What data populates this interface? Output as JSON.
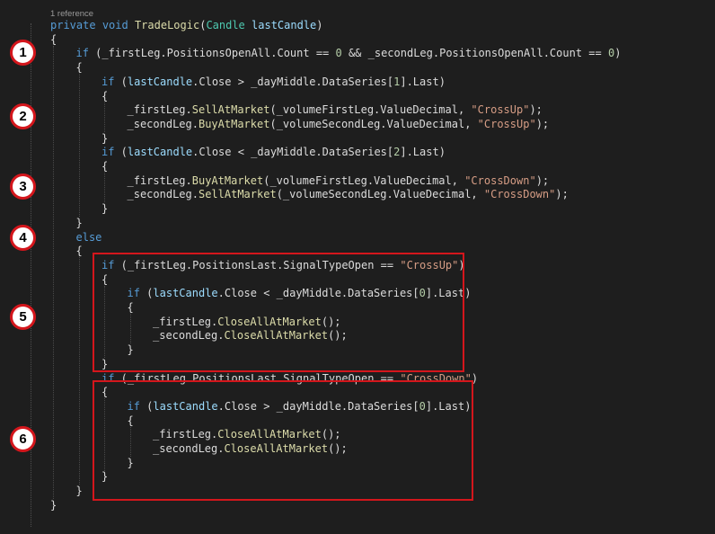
{
  "codelens": "1 reference",
  "markers": [
    "1",
    "2",
    "3",
    "4",
    "5",
    "6"
  ],
  "colors": {
    "background": "#1e1e1e",
    "keyword": "#569cd6",
    "method": "#dcdcaa",
    "type": "#4ec9b0",
    "parameter": "#9cdcfe",
    "string": "#d69d85",
    "number": "#b5cea8",
    "highlight": "#d4161c"
  },
  "code": [
    {
      "indent": 0,
      "tokens": [
        {
          "t": "private",
          "c": "kw"
        },
        {
          "t": " "
        },
        {
          "t": "void",
          "c": "kw"
        },
        {
          "t": " "
        },
        {
          "t": "TradeLogic",
          "c": "fn"
        },
        {
          "t": "("
        },
        {
          "t": "Candle",
          "c": "ty"
        },
        {
          "t": " "
        },
        {
          "t": "lastCandle",
          "c": "pa"
        },
        {
          "t": ")"
        }
      ]
    },
    {
      "indent": 0,
      "tokens": [
        {
          "t": "{"
        }
      ]
    },
    {
      "indent": 1,
      "tokens": [
        {
          "t": "if",
          "c": "kw"
        },
        {
          "t": " (_firstLeg.PositionsOpenAll.Count == "
        },
        {
          "t": "0",
          "c": "nu"
        },
        {
          "t": " && _secondLeg.PositionsOpenAll.Count == "
        },
        {
          "t": "0",
          "c": "nu"
        },
        {
          "t": ")"
        }
      ]
    },
    {
      "indent": 1,
      "tokens": [
        {
          "t": "{"
        }
      ]
    },
    {
      "indent": 2,
      "tokens": [
        {
          "t": "if",
          "c": "kw"
        },
        {
          "t": " ("
        },
        {
          "t": "lastCandle",
          "c": "pa"
        },
        {
          "t": ".Close > _dayMiddle.DataSeries["
        },
        {
          "t": "1",
          "c": "nu"
        },
        {
          "t": "].Last)"
        }
      ]
    },
    {
      "indent": 2,
      "tokens": [
        {
          "t": "{"
        }
      ]
    },
    {
      "indent": 3,
      "tokens": [
        {
          "t": "_firstLeg."
        },
        {
          "t": "SellAtMarket",
          "c": "fn"
        },
        {
          "t": "(_volumeFirstLeg.ValueDecimal, "
        },
        {
          "t": "\"CrossUp\"",
          "c": "st"
        },
        {
          "t": ");"
        }
      ]
    },
    {
      "indent": 3,
      "tokens": [
        {
          "t": "_secondLeg."
        },
        {
          "t": "BuyAtMarket",
          "c": "fn"
        },
        {
          "t": "(_volumeSecondLeg.ValueDecimal, "
        },
        {
          "t": "\"CrossUp\"",
          "c": "st"
        },
        {
          "t": ");"
        }
      ]
    },
    {
      "indent": 2,
      "tokens": [
        {
          "t": "}"
        }
      ]
    },
    {
      "indent": 2,
      "tokens": [
        {
          "t": "if",
          "c": "kw"
        },
        {
          "t": " ("
        },
        {
          "t": "lastCandle",
          "c": "pa"
        },
        {
          "t": ".Close < _dayMiddle.DataSeries["
        },
        {
          "t": "2",
          "c": "nu"
        },
        {
          "t": "].Last)"
        }
      ]
    },
    {
      "indent": 2,
      "tokens": [
        {
          "t": "{"
        }
      ]
    },
    {
      "indent": 3,
      "tokens": [
        {
          "t": "_firstLeg."
        },
        {
          "t": "BuyAtMarket",
          "c": "fn"
        },
        {
          "t": "(_volumeFirstLeg.ValueDecimal, "
        },
        {
          "t": "\"CrossDown\"",
          "c": "st"
        },
        {
          "t": ");"
        }
      ]
    },
    {
      "indent": 3,
      "tokens": [
        {
          "t": "_secondLeg."
        },
        {
          "t": "SellAtMarket",
          "c": "fn"
        },
        {
          "t": "(_volumeSecondLeg.ValueDecimal, "
        },
        {
          "t": "\"CrossDown\"",
          "c": "st"
        },
        {
          "t": ");"
        }
      ]
    },
    {
      "indent": 2,
      "tokens": [
        {
          "t": "}"
        }
      ]
    },
    {
      "indent": 1,
      "tokens": [
        {
          "t": "}"
        }
      ]
    },
    {
      "indent": 1,
      "tokens": [
        {
          "t": "else",
          "c": "kw"
        }
      ]
    },
    {
      "indent": 1,
      "tokens": [
        {
          "t": "{"
        }
      ]
    },
    {
      "indent": 2,
      "tokens": [
        {
          "t": "if",
          "c": "kw"
        },
        {
          "t": " (_firstLeg.PositionsLast.SignalTypeOpen == "
        },
        {
          "t": "\"CrossUp\"",
          "c": "st"
        },
        {
          "t": ")"
        }
      ]
    },
    {
      "indent": 2,
      "tokens": [
        {
          "t": "{"
        }
      ]
    },
    {
      "indent": 3,
      "tokens": [
        {
          "t": "if",
          "c": "kw"
        },
        {
          "t": " ("
        },
        {
          "t": "lastCandle",
          "c": "pa"
        },
        {
          "t": ".Close < _dayMiddle.DataSeries["
        },
        {
          "t": "0",
          "c": "nu"
        },
        {
          "t": "].Last)"
        }
      ]
    },
    {
      "indent": 3,
      "tokens": [
        {
          "t": "{"
        }
      ]
    },
    {
      "indent": 4,
      "tokens": [
        {
          "t": "_firstLeg."
        },
        {
          "t": "CloseAllAtMarket",
          "c": "fn"
        },
        {
          "t": "();"
        }
      ]
    },
    {
      "indent": 4,
      "tokens": [
        {
          "t": "_secondLeg."
        },
        {
          "t": "CloseAllAtMarket",
          "c": "fn"
        },
        {
          "t": "();"
        }
      ]
    },
    {
      "indent": 3,
      "tokens": [
        {
          "t": "}"
        }
      ]
    },
    {
      "indent": 2,
      "tokens": [
        {
          "t": "}"
        }
      ]
    },
    {
      "indent": 2,
      "tokens": [
        {
          "t": "if",
          "c": "kw"
        },
        {
          "t": " (_firstLeg.PositionsLast.SignalTypeOpen == "
        },
        {
          "t": "\"CrossDown\"",
          "c": "st"
        },
        {
          "t": ")"
        }
      ]
    },
    {
      "indent": 2,
      "tokens": [
        {
          "t": "{"
        }
      ]
    },
    {
      "indent": 3,
      "tokens": [
        {
          "t": "if",
          "c": "kw"
        },
        {
          "t": " ("
        },
        {
          "t": "lastCandle",
          "c": "pa"
        },
        {
          "t": ".Close > _dayMiddle.DataSeries["
        },
        {
          "t": "0",
          "c": "nu"
        },
        {
          "t": "].Last)"
        }
      ]
    },
    {
      "indent": 3,
      "tokens": [
        {
          "t": "{"
        }
      ]
    },
    {
      "indent": 4,
      "tokens": [
        {
          "t": "_firstLeg."
        },
        {
          "t": "CloseAllAtMarket",
          "c": "fn"
        },
        {
          "t": "();"
        }
      ]
    },
    {
      "indent": 4,
      "tokens": [
        {
          "t": "_secondLeg."
        },
        {
          "t": "CloseAllAtMarket",
          "c": "fn"
        },
        {
          "t": "();"
        }
      ]
    },
    {
      "indent": 3,
      "tokens": [
        {
          "t": "}"
        }
      ]
    },
    {
      "indent": 2,
      "tokens": [
        {
          "t": "}"
        }
      ]
    },
    {
      "indent": 1,
      "tokens": [
        {
          "t": "}"
        }
      ]
    },
    {
      "indent": 0,
      "tokens": [
        {
          "t": "}"
        }
      ]
    }
  ]
}
